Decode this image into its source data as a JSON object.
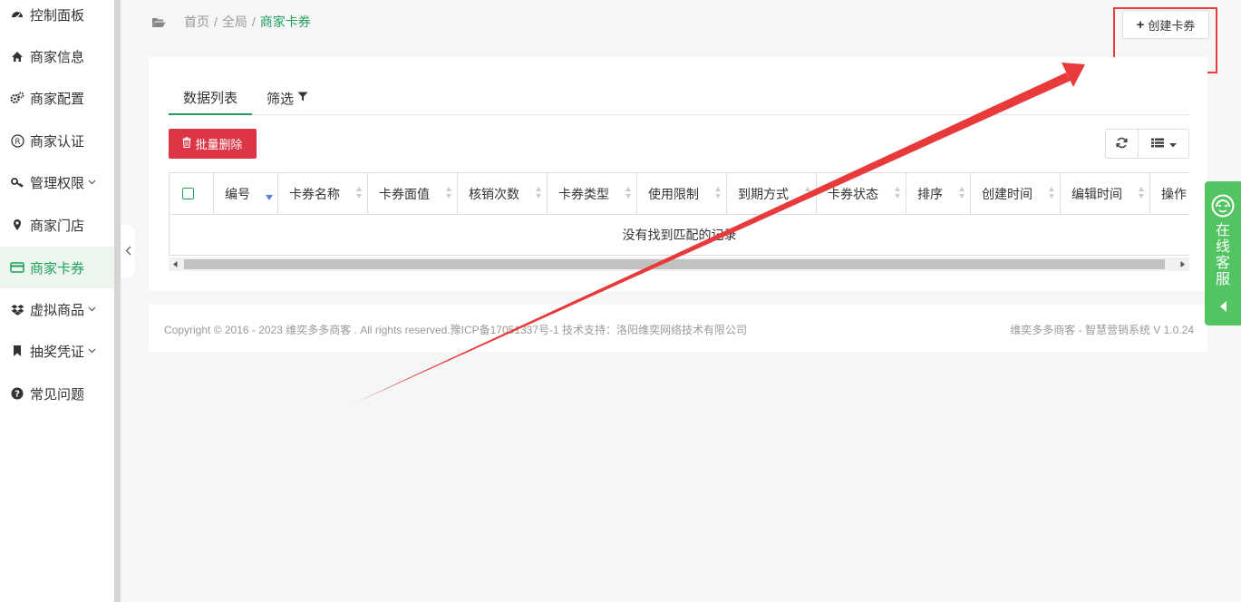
{
  "sidebar": {
    "items": [
      {
        "label": "控制面板",
        "icon": "dashboard-icon",
        "chevron": false,
        "active": false
      },
      {
        "label": "商家信息",
        "icon": "home-icon",
        "chevron": false,
        "active": false
      },
      {
        "label": "商家配置",
        "icon": "gears-icon",
        "chevron": false,
        "active": false
      },
      {
        "label": "商家认证",
        "icon": "registered-icon",
        "chevron": false,
        "active": false
      },
      {
        "label": "管理权限",
        "icon": "key-icon",
        "chevron": true,
        "active": false
      },
      {
        "label": "商家门店",
        "icon": "map-marker-icon",
        "chevron": false,
        "active": false
      },
      {
        "label": "商家卡券",
        "icon": "credit-card-icon",
        "chevron": false,
        "active": true
      },
      {
        "label": "虚拟商品",
        "icon": "dropbox-icon",
        "chevron": true,
        "active": false
      },
      {
        "label": "抽奖凭证",
        "icon": "bookmark-icon",
        "chevron": true,
        "active": false
      },
      {
        "label": "常见问题",
        "icon": "question-circle-icon",
        "chevron": false,
        "active": false
      }
    ]
  },
  "breadcrumb": {
    "home": "首页",
    "sep1": "/",
    "level2": "全局",
    "sep2": "/",
    "current": "商家卡券"
  },
  "toolbar": {
    "create_label": "创建卡券",
    "batch_delete_label": "批量删除"
  },
  "tabs": [
    {
      "label": "数据列表"
    },
    {
      "label": "筛选"
    }
  ],
  "table": {
    "columns": [
      {
        "label": ""
      },
      {
        "label": "编号"
      },
      {
        "label": "卡券名称"
      },
      {
        "label": "卡券面值"
      },
      {
        "label": "核销次数"
      },
      {
        "label": "卡券类型"
      },
      {
        "label": "使用限制"
      },
      {
        "label": "到期方式"
      },
      {
        "label": "卡券状态"
      },
      {
        "label": "排序"
      },
      {
        "label": "创建时间"
      },
      {
        "label": "编辑时间"
      },
      {
        "label": "操作"
      }
    ],
    "empty_text": "没有找到匹配的记录"
  },
  "footer": {
    "copyright": "Copyright © 2016 - 2023 维奕多多商客 . All rights reserved.豫ICP备17051337号-1 技术支持：洛阳维奕网络技术有限公司",
    "version": "维奕多多商客 - 智慧营销系统 V 1.0.24"
  },
  "customer_service": {
    "label": "在线客服"
  },
  "colors": {
    "accent": "#21a05a",
    "danger": "#dc3545",
    "annotation": "#e83a3a",
    "cs_green": "#52c461"
  }
}
